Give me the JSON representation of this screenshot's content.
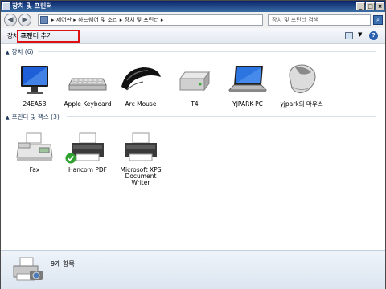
{
  "window": {
    "title": "장치 및 프린터"
  },
  "address": {
    "path": "▸ 제어판 ▸ 하드웨어 및 소리 ▸ 장치 및 프린터 ▸",
    "search_placeholder": "장치 및 프린터 검색"
  },
  "toolbar": {
    "add_device": "장치 추가",
    "add_printer": "프린터 추가"
  },
  "groups": {
    "devices": {
      "label": "장치 (6)"
    },
    "printers": {
      "label": "프린터 및 팩스 (3)"
    }
  },
  "devices": [
    {
      "label": "24EA53",
      "icon": "monitor-icon"
    },
    {
      "label": "Apple Keyboard",
      "icon": "keyboard-icon"
    },
    {
      "label": "Arc Mouse",
      "icon": "arc-mouse-icon"
    },
    {
      "label": "T4",
      "icon": "drive-icon"
    },
    {
      "label": "YJPARK-PC",
      "icon": "laptop-icon"
    },
    {
      "label": "yjpark의 마우스",
      "icon": "mouse-icon"
    }
  ],
  "printers": [
    {
      "label": "Fax",
      "icon": "fax-icon"
    },
    {
      "label": "Hancom PDF",
      "icon": "printer-icon",
      "default": true
    },
    {
      "label_line1": "Microsoft XPS",
      "label_line2": "Document Writer",
      "icon": "printer-icon"
    }
  ],
  "status": {
    "count": "9개 항목"
  }
}
